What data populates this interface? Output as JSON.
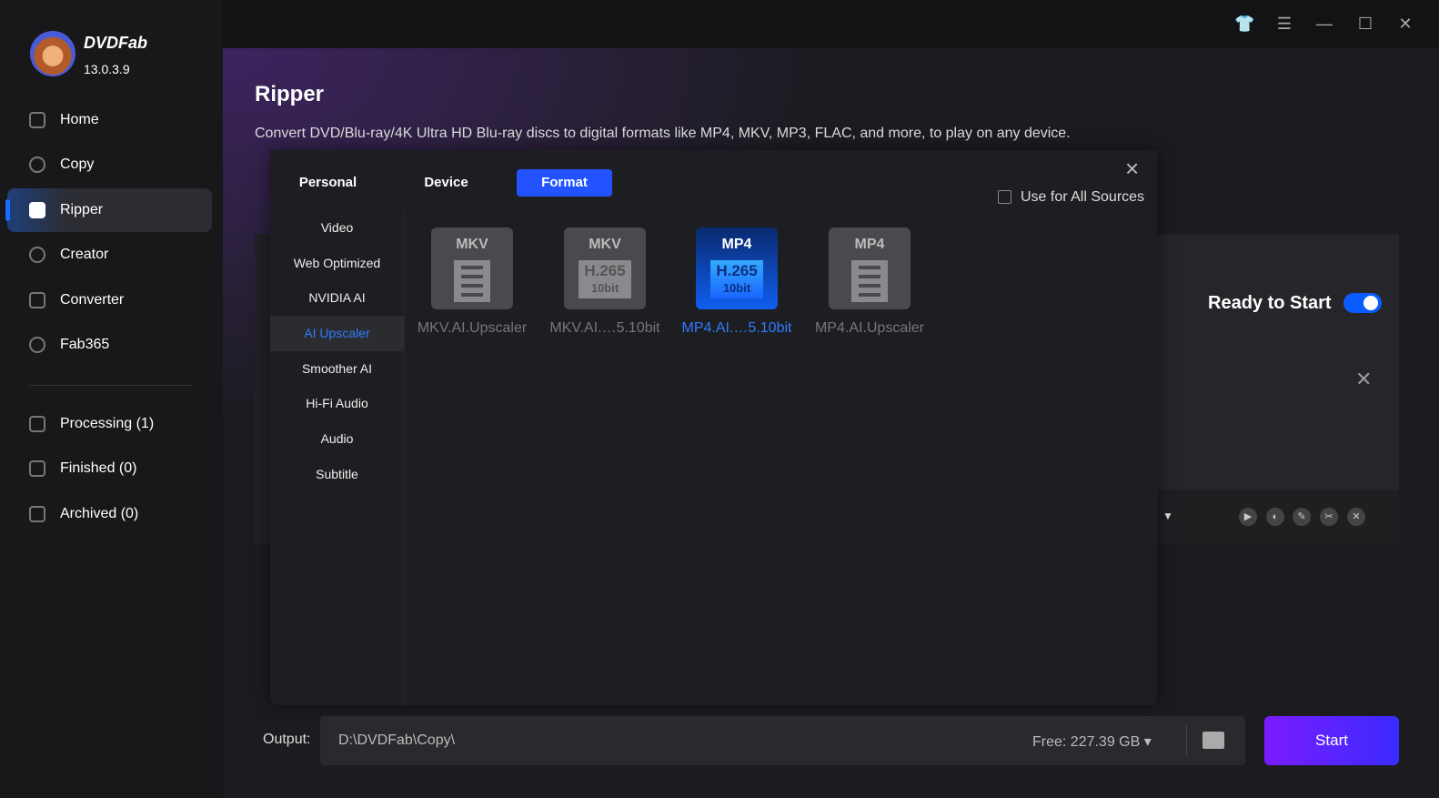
{
  "app": {
    "brand": "DVDFab",
    "version": "13.0.3.9"
  },
  "sidebar": {
    "items": [
      {
        "label": "Home"
      },
      {
        "label": "Copy"
      },
      {
        "label": "Ripper"
      },
      {
        "label": "Creator"
      },
      {
        "label": "Converter"
      },
      {
        "label": "Fab365"
      }
    ],
    "status": [
      {
        "label": "Processing (1)"
      },
      {
        "label": "Finished (0)"
      },
      {
        "label": "Archived (0)"
      }
    ]
  },
  "page": {
    "title": "Ripper",
    "description": "Convert DVD/Blu-ray/4K Ultra HD Blu-ray discs to digital formats like MP4, MKV, MP3, FLAC, and more, to play on any device."
  },
  "dialog": {
    "tabs": [
      "Personal",
      "Device",
      "Format"
    ],
    "use_all": "Use for All Sources",
    "categories": [
      "Video",
      "Web Optimized",
      "NVIDIA AI",
      "AI Upscaler",
      "Smoother AI",
      "Hi-Fi Audio",
      "Audio",
      "Subtitle"
    ],
    "formats": [
      {
        "badge": "MKV",
        "codec": "",
        "bit": "",
        "label": "MKV.AI.Upscaler"
      },
      {
        "badge": "MKV",
        "codec": "H.265",
        "bit": "10bit",
        "label": "MKV.AI.…5.10bit"
      },
      {
        "badge": "MP4",
        "codec": "H.265",
        "bit": "10bit",
        "label": "MP4.AI.…5.10bit"
      },
      {
        "badge": "MP4",
        "codec": "",
        "bit": "",
        "label": "MP4.AI.Upscaler"
      }
    ]
  },
  "task": {
    "status": "Ready to Start"
  },
  "output": {
    "label": "Output:",
    "path": "D:\\DVDFab\\Copy\\",
    "free": "Free: 227.39 GB ▾",
    "start": "Start"
  }
}
